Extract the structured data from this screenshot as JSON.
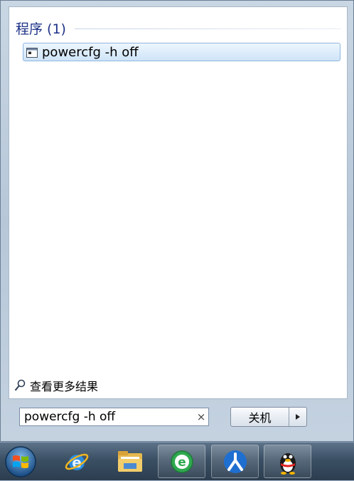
{
  "results": {
    "section_title": "程序 (1)",
    "items": [
      {
        "label": "powercfg -h off",
        "icon": "console-window-icon"
      }
    ]
  },
  "see_more": {
    "label": "查看更多结果",
    "icon": "search-icon"
  },
  "search": {
    "value": "powercfg -h off",
    "clear_glyph": "×"
  },
  "shutdown": {
    "label": "关机",
    "arrow_glyph": "▸"
  },
  "taskbar": {
    "items": [
      {
        "name": "start-orb",
        "icon": "windows-logo-icon"
      },
      {
        "name": "internet-explorer",
        "icon": "internet-explorer-icon"
      },
      {
        "name": "file-explorer",
        "icon": "folder-icon"
      },
      {
        "name": "green-browser",
        "icon": "green-e-browser-icon"
      },
      {
        "name": "renren",
        "icon": "renren-icon"
      },
      {
        "name": "qq",
        "icon": "qq-penguin-icon"
      }
    ]
  },
  "colors": {
    "header_text": "#1e3287",
    "selection_border": "#8fb6df",
    "taskbar": "#3b5064"
  }
}
